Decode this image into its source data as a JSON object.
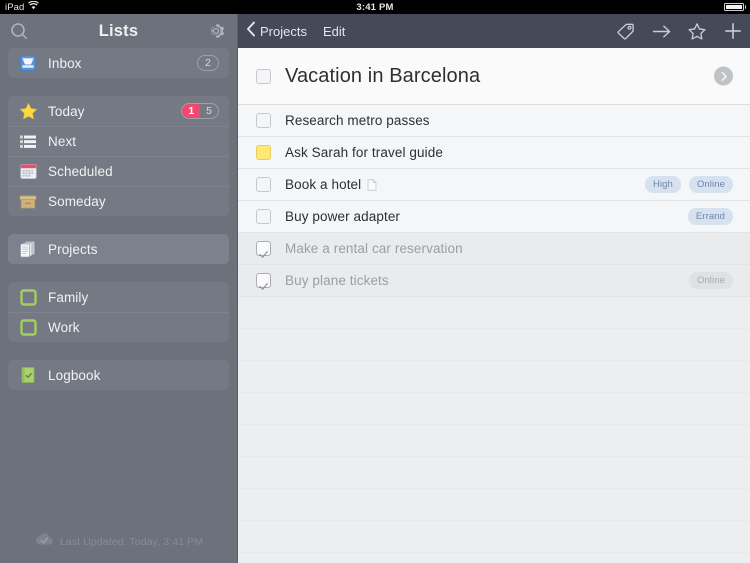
{
  "statusbar": {
    "device": "iPad",
    "wifi_icon": "wifi-icon",
    "time": "3:41 PM",
    "battery_icon": "battery-full-icon"
  },
  "sidebar": {
    "title": "Lists",
    "search_icon": "search-icon",
    "settings_icon": "gear-icon",
    "groups": [
      {
        "items": [
          {
            "label": "Inbox",
            "icon": "inbox-tray-icon",
            "badge": "2",
            "selected": false
          }
        ]
      },
      {
        "items": [
          {
            "label": "Today",
            "icon": "star-icon",
            "badge_due": "1",
            "badge_count": "5",
            "selected": false
          },
          {
            "label": "Next",
            "icon": "list-stack-icon",
            "selected": false
          },
          {
            "label": "Scheduled",
            "icon": "calendar-icon",
            "selected": false
          },
          {
            "label": "Someday",
            "icon": "box-icon",
            "selected": false
          }
        ]
      },
      {
        "items": [
          {
            "label": "Projects",
            "icon": "pages-stack-icon",
            "selected": true
          }
        ]
      },
      {
        "items": [
          {
            "label": "Family",
            "icon": "green-square-icon",
            "selected": false
          },
          {
            "label": "Work",
            "icon": "green-square-icon",
            "selected": false
          }
        ]
      },
      {
        "items": [
          {
            "label": "Logbook",
            "icon": "green-book-check-icon",
            "selected": false
          }
        ]
      }
    ],
    "footer": {
      "icon": "cloud-check-icon",
      "text": "Last Updated: Today, 3:41 PM"
    }
  },
  "main": {
    "toolbar": {
      "back_icon": "chevron-left-icon",
      "back_label": "Projects",
      "edit_label": "Edit",
      "actions": [
        {
          "icon": "tag-icon",
          "name": "tag-button"
        },
        {
          "icon": "arrow-right-icon",
          "name": "move-button"
        },
        {
          "icon": "star-outline-icon",
          "name": "star-button"
        },
        {
          "icon": "plus-icon",
          "name": "add-button"
        }
      ]
    },
    "project": {
      "title": "Vacation in Barcelona",
      "checkbox_state": "unchecked",
      "detail_icon": "chevron-right-circle-icon"
    },
    "tasks": [
      {
        "label": "Research metro passes",
        "state": "unchecked",
        "checkbox_color": "",
        "note": false,
        "tags": []
      },
      {
        "label": "Ask Sarah for travel guide",
        "state": "unchecked",
        "checkbox_color": "#ffe873",
        "note": false,
        "tags": []
      },
      {
        "label": "Book a hotel",
        "state": "unchecked",
        "checkbox_color": "",
        "note": true,
        "tags": [
          "High",
          "Online"
        ]
      },
      {
        "label": "Buy power adapter",
        "state": "unchecked",
        "checkbox_color": "",
        "note": false,
        "tags": [
          "Errand"
        ]
      },
      {
        "label": "Make a rental car reservation",
        "state": "checked",
        "checkbox_color": "",
        "note": false,
        "tags": []
      },
      {
        "label": "Buy plane tickets",
        "state": "checked",
        "checkbox_color": "",
        "note": false,
        "tags": [
          "Online"
        ]
      }
    ],
    "empty_row_count": 8
  },
  "colors": {
    "sidebar_bg": "#6d717b",
    "sidebar_group": "#747983",
    "toolbar_bg": "#454a58",
    "list_bg": "#edeef0",
    "row_bg": "#f5f6f7",
    "row_done_bg": "#eaebed",
    "tag_blue_text": "#6f86a8",
    "tag_blue_bg": "#d7e2f1",
    "badge_due": "#f0486e",
    "accent_yellow": "#ffe873",
    "accent_green": "#9ccc5a"
  }
}
